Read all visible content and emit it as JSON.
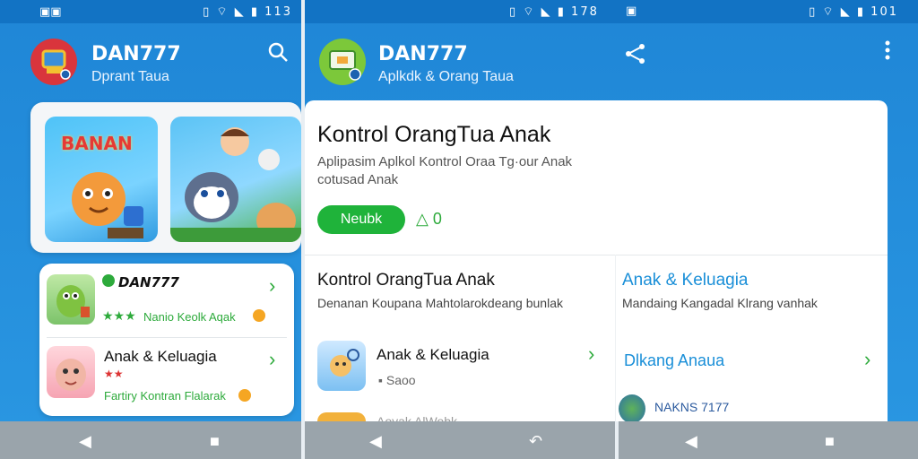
{
  "status": {
    "s1_left": "▣▣",
    "s1_right": "▯ ⌔ ◣ ▮ 113",
    "s2_right": "▯ ⌔ ◣ ▮ 178",
    "s3_left": "▣",
    "s3_right": "▯ ⌔ ◣ ▮ 101"
  },
  "screen1": {
    "app_title": "DAN777",
    "app_subtitle": "Dprant Taua",
    "banner_text": "BANAN",
    "items": [
      {
        "title": "DAN777",
        "subtitle": "Nanio Keolk Aqak",
        "rating": "★★★"
      },
      {
        "title": "Anak & Keluagia",
        "subtitle": "Fartiry Kontran Flalarak",
        "rating": "★★"
      }
    ]
  },
  "screen2": {
    "app_title": "DAN777",
    "app_subtitle": "Aplkdk & Orang Taua",
    "hero_title": "Kontrol OrangTua Anak",
    "hero_desc_line1": "Aplipasim Aplkol Kontrol Oraa Tg·our Anak",
    "hero_desc_line2": "cotusad Anak",
    "install_label": "Neubk",
    "like_count": "0",
    "section1_title": "Kontrol OrangTua Anak",
    "section1_desc": "Denanan Koupana Mahtolarokdeang bunlak",
    "section2_title": "Anak & Keluagia",
    "section2_desc": "Mandaing Kangadal Klrang vanhak",
    "list_item_title": "Anak & Keluagia",
    "list_item_sub": "Saoo",
    "link_label": "Dlkang Anaua",
    "bottom_label": "NAKNS 7177",
    "partial_label": "Aoyak AlWobk"
  },
  "colors": {
    "bar": "#1273c4",
    "accent_green": "#1fb33a",
    "link_blue": "#1a8fd8"
  }
}
